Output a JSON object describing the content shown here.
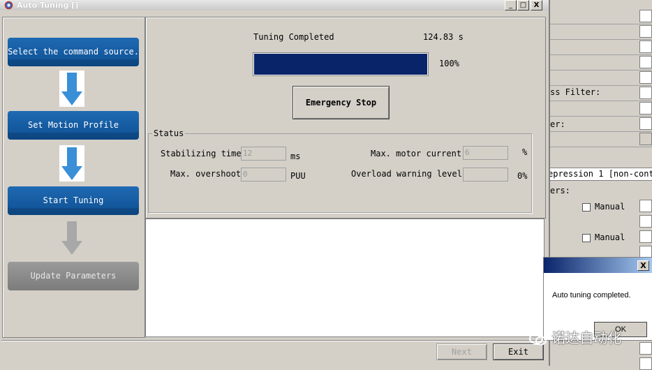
{
  "window": {
    "title": "Auto Tuning []",
    "minimize": "_",
    "maximize": "□",
    "close": "X"
  },
  "steps": [
    {
      "label": "Select the command source.",
      "state": "active"
    },
    {
      "label": "Set Motion Profile",
      "state": "active"
    },
    {
      "label": "Start Tuning",
      "state": "active"
    },
    {
      "label": "Update Parameters",
      "state": "disabled"
    }
  ],
  "tuning": {
    "status_label": "Tuning Completed",
    "elapsed": "124.83 s",
    "progress_percent": 100,
    "progress_text": "100%",
    "emergency_stop_label": "Emergency Stop"
  },
  "status": {
    "legend": "Status",
    "stabilizing_time_label": "Stabilizing time",
    "stabilizing_time_value": "12",
    "stabilizing_time_unit": "ms",
    "max_overshoot_label": "Max. overshoot",
    "max_overshoot_value": "0",
    "max_overshoot_unit": "PUU",
    "max_motor_current_label": "Max. motor current",
    "max_motor_current_value": "6",
    "max_motor_current_unit": "%",
    "overload_warning_label": "Overload warning level",
    "overload_warning_value": "",
    "overload_warning_unit": "0%"
  },
  "buttons": {
    "next": "Next",
    "exit": "Exit"
  },
  "background_window": {
    "filter_label": "ss Filter:",
    "er_label": "er:",
    "suppression_label": "epression 1 [non-conti",
    "ers_label": "ers:",
    "manual_1": "Manual",
    "manual_2": "Manual"
  },
  "dialog": {
    "close": "X",
    "message": "Auto tuning completed.",
    "ok": "OK"
  },
  "watermark": "诺达自动化",
  "colors": {
    "accent_blue": "#0e4f92",
    "progress_blue": "#0a246a",
    "window_bg": "#d4d0c8"
  }
}
